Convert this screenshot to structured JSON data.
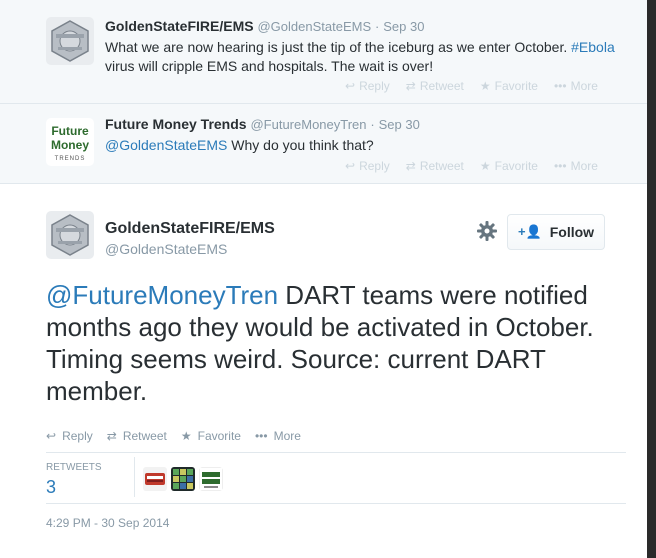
{
  "context_tweets": [
    {
      "name": "GoldenStateFIRE/EMS",
      "handle": "@GoldenStateEMS",
      "separator": "·",
      "time": "Sep 30",
      "text_part1": "What we are now hearing is just the tip of the iceburg as we enter October.",
      "hashtag": "#Ebola",
      "text_part2": " virus will cripple EMS and hospitals. The wait is over!",
      "actions": {
        "reply": "Reply",
        "retweet": "Retweet",
        "favorite": "Favorite",
        "more": "More"
      }
    },
    {
      "name": "Future Money Trends",
      "handle": "@FutureMoneyTren",
      "separator": "·",
      "time": "Sep 30",
      "mention": "@GoldenStateEMS",
      "text": " Why do you think that?",
      "avatar_line1": "Future",
      "avatar_line2": "Money",
      "avatar_line3": "TRENDS",
      "actions": {
        "reply": "Reply",
        "retweet": "Retweet",
        "favorite": "Favorite",
        "more": "More"
      }
    }
  ],
  "main_tweet": {
    "name": "GoldenStateFIRE/EMS",
    "handle": "@GoldenStateEMS",
    "follow_label": "Follow",
    "mention": "@FutureMoneyTren",
    "text": " DART teams were notified months ago they would be activated in October. Timing seems weird. Source: current DART member.",
    "actions": {
      "reply": "Reply",
      "retweet": "Retweet",
      "favorite": "Favorite",
      "more": "More"
    },
    "stats": {
      "label": "RETWEETS",
      "value": "3"
    },
    "timestamp": "4:29 PM - 30 Sep 2014"
  },
  "colors": {
    "link": "#2b7bb9",
    "muted": "#8899a6",
    "background_context": "#f5f8fa"
  }
}
